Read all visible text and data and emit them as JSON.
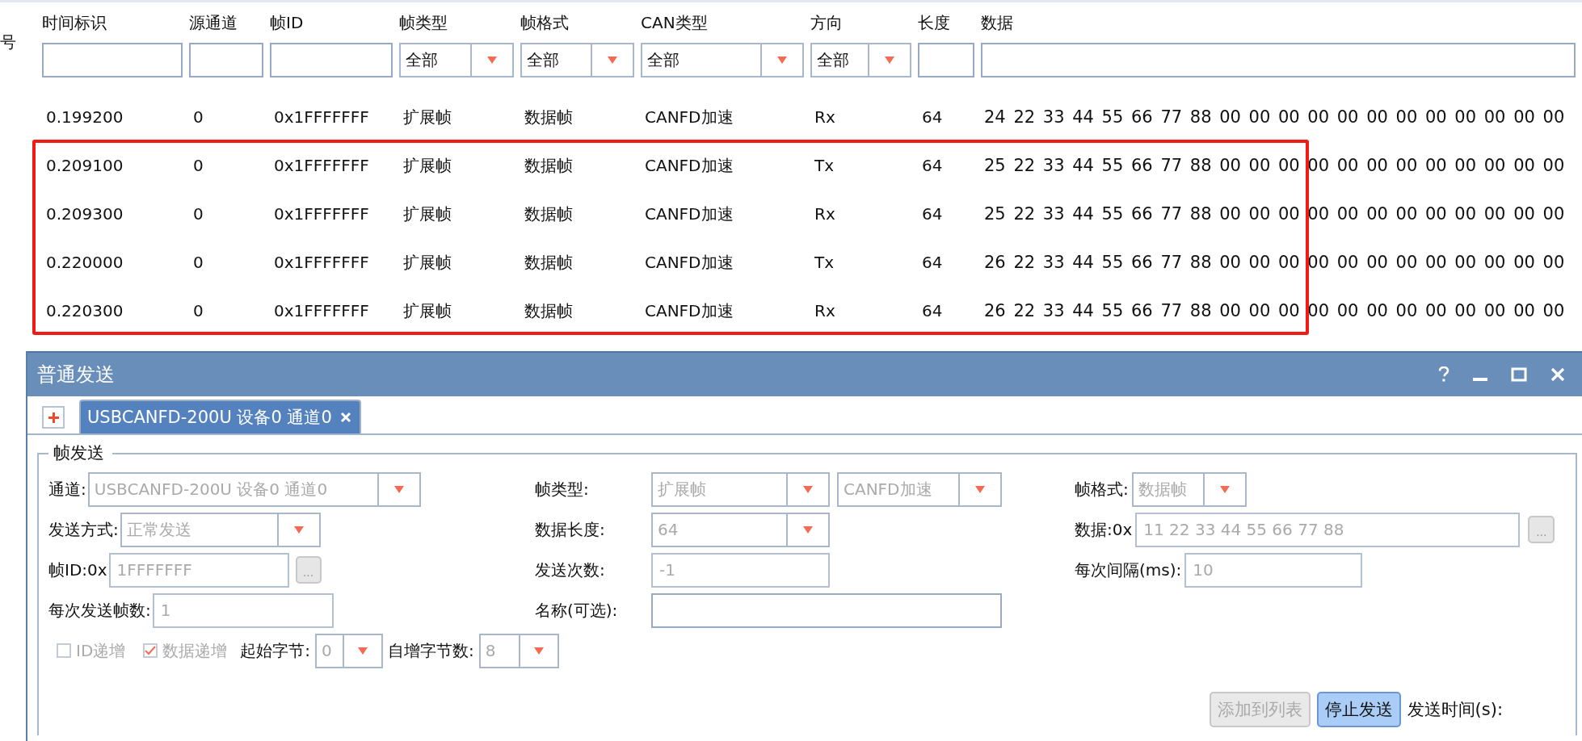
{
  "table": {
    "partial_header": "号",
    "columns": [
      {
        "header": "时间标识",
        "filter": {
          "kind": "text"
        }
      },
      {
        "header": "源通道",
        "filter": {
          "kind": "text"
        }
      },
      {
        "header": "帧ID",
        "filter": {
          "kind": "text"
        }
      },
      {
        "header": "帧类型",
        "filter": {
          "kind": "combo",
          "value": "全部"
        }
      },
      {
        "header": "帧格式",
        "filter": {
          "kind": "combo",
          "value": "全部"
        }
      },
      {
        "header": "CAN类型",
        "filter": {
          "kind": "combo",
          "value": "全部"
        }
      },
      {
        "header": "方向",
        "filter": {
          "kind": "combo",
          "value": "全部"
        }
      },
      {
        "header": "长度",
        "filter": {
          "kind": "text"
        }
      },
      {
        "header": "数据",
        "filter": {
          "kind": "text"
        }
      }
    ],
    "rows": [
      {
        "highlighted": false,
        "cells": [
          "0.199200",
          "0",
          "0x1FFFFFFF",
          "扩展帧",
          "数据帧",
          "CANFD加速",
          "Rx",
          "64",
          "24 22 33 44 55 66 77 88 00 00 00 00 00 00 00 00 00 00 00 00"
        ]
      },
      {
        "highlighted": true,
        "cells": [
          "0.209100",
          "0",
          "0x1FFFFFFF",
          "扩展帧",
          "数据帧",
          "CANFD加速",
          "Tx",
          "64",
          "25 22 33 44 55 66 77 88 00 00 00 00 00 00 00 00 00 00 00 00"
        ]
      },
      {
        "highlighted": true,
        "cells": [
          "0.209300",
          "0",
          "0x1FFFFFFF",
          "扩展帧",
          "数据帧",
          "CANFD加速",
          "Rx",
          "64",
          "25 22 33 44 55 66 77 88 00 00 00 00 00 00 00 00 00 00 00 00"
        ]
      },
      {
        "highlighted": true,
        "cells": [
          "0.220000",
          "0",
          "0x1FFFFFFF",
          "扩展帧",
          "数据帧",
          "CANFD加速",
          "Tx",
          "64",
          "26 22 33 44 55 66 77 88 00 00 00 00 00 00 00 00 00 00 00 00"
        ]
      },
      {
        "highlighted": true,
        "cells": [
          "0.220300",
          "0",
          "0x1FFFFFFF",
          "扩展帧",
          "数据帧",
          "CANFD加速",
          "Rx",
          "64",
          "26 22 33 44 55 66 77 88 00 00 00 00 00 00 00 00 00 00 00 00"
        ]
      }
    ]
  },
  "send_panel": {
    "title": "普通发送",
    "tabs": [
      {
        "label": "USBCANFD-200U 设备0 通道0",
        "selected": true
      }
    ],
    "group_title": "帧发送",
    "form_rows": [
      [
        {
          "label": "通道:",
          "controls": [
            {
              "kind": "combo",
              "value": "USBCANFD-200U 设备0 通道0",
              "disabled": true
            }
          ]
        },
        {
          "label": "帧类型:",
          "controls": [
            {
              "kind": "combo",
              "value": "扩展帧",
              "disabled": true
            },
            {
              "kind": "combo",
              "value": "CANFD加速",
              "disabled": true
            }
          ]
        },
        {
          "label": "帧格式:",
          "controls": [
            {
              "kind": "combo",
              "value": "数据帧",
              "disabled": true
            }
          ]
        }
      ],
      [
        {
          "label": "发送方式:",
          "controls": [
            {
              "kind": "combo",
              "value": "正常发送",
              "disabled": true
            }
          ]
        },
        {
          "label": "数据长度:",
          "controls": [
            {
              "kind": "combo",
              "value": "64",
              "disabled": true
            }
          ]
        },
        {
          "label": "数据:0x",
          "controls": [
            {
              "kind": "input",
              "value": "11 22 33 44 55 66 77 88",
              "disabled": true
            },
            {
              "kind": "button",
              "value": "...",
              "disabled": true
            }
          ]
        }
      ],
      [
        {
          "label": "帧ID:0x",
          "controls": [
            {
              "kind": "input",
              "value": "1FFFFFFF",
              "disabled": true
            },
            {
              "kind": "button",
              "value": "...",
              "disabled": true
            }
          ]
        },
        {
          "label": "发送次数:",
          "controls": [
            {
              "kind": "input",
              "value": "-1",
              "disabled": true
            }
          ]
        },
        {
          "label": "每次间隔(ms):",
          "controls": [
            {
              "kind": "input",
              "value": "10",
              "disabled": true
            }
          ]
        }
      ],
      [
        {
          "label": "每次发送帧数:",
          "controls": [
            {
              "kind": "input",
              "value": "1",
              "disabled": true
            }
          ]
        },
        {
          "label": "名称(可选):",
          "controls": [
            {
              "kind": "input",
              "disabled": false
            }
          ]
        }
      ]
    ],
    "options": [
      {
        "kind": "checkbox",
        "label": "ID递增",
        "checked": false,
        "disabled": true
      },
      {
        "kind": "checkbox",
        "label": "数据递增",
        "checked": true,
        "disabled": true
      },
      {
        "kind": "combo",
        "label": "起始字节:",
        "value": "0",
        "disabled": true
      },
      {
        "kind": "combo",
        "label": "自增字节数:",
        "value": "8",
        "disabled": true
      }
    ],
    "buttons": [
      {
        "label": "添加到列表",
        "disabled": true
      },
      {
        "label": "停止发送",
        "disabled": false
      }
    ],
    "send_time_label": "发送时间(s):"
  }
}
